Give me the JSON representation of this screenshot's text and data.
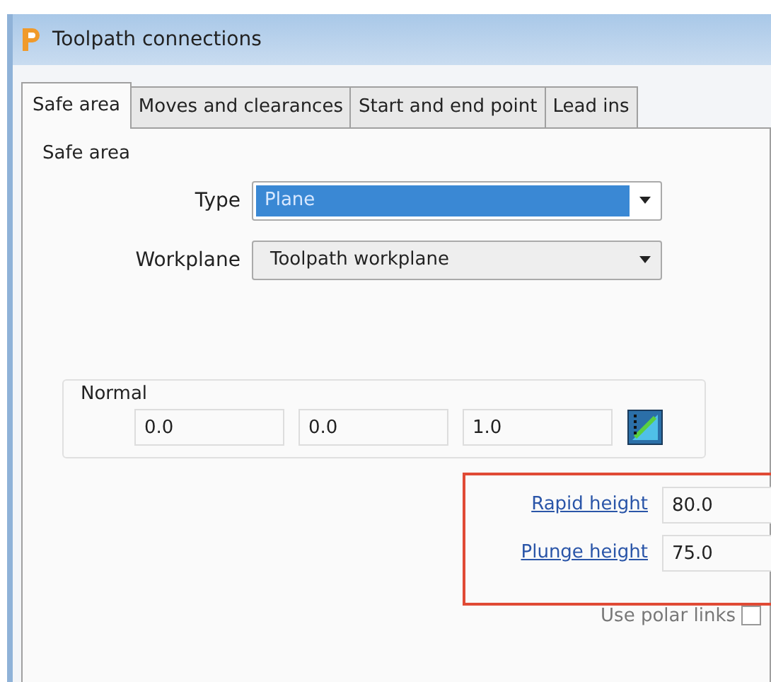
{
  "window": {
    "title": "Toolpath connections"
  },
  "tabs": [
    {
      "label": "Safe area",
      "selected": true
    },
    {
      "label": "Moves and clearances",
      "selected": false
    },
    {
      "label": "Start and end point",
      "selected": false
    },
    {
      "label": "Lead ins",
      "selected": false
    }
  ],
  "safe_area": {
    "title": "Safe area",
    "fields": [
      {
        "label": "Type",
        "value": "Plane",
        "focused": true
      },
      {
        "label": "Workplane",
        "value": "Toolpath workplane",
        "focused": false
      }
    ]
  },
  "normal": {
    "title": "Normal",
    "values": [
      "0.0",
      "0.0",
      "1.0"
    ]
  },
  "heights": [
    {
      "label": "Rapid height",
      "value": "80.0"
    },
    {
      "label": "Plunge height",
      "value": "75.0"
    }
  ],
  "use_polar_links": {
    "label": "Use polar links",
    "checked": false
  }
}
